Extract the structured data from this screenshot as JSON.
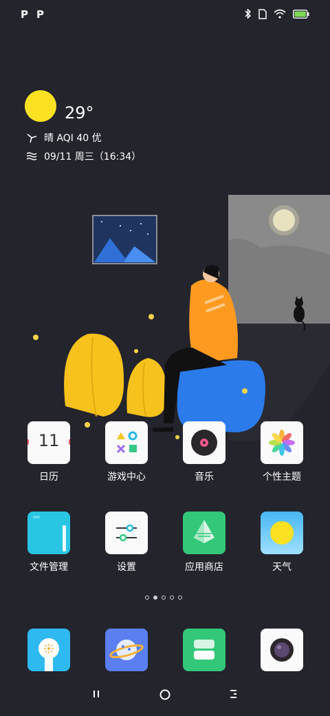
{
  "status_bar": {
    "left_icons": [
      "P",
      "P"
    ],
    "icons": [
      "bluetooth-icon",
      "sim-icon",
      "wifi-icon",
      "battery-icon"
    ],
    "battery_color": "#7ed957"
  },
  "weather": {
    "temperature": "29°",
    "condition_line": "晴 AQI 40 优",
    "date_line": "09/11 周三（16:34）",
    "sun_color": "#fbe122"
  },
  "apps_row1": [
    {
      "label": "日历",
      "icon": "calendar-icon",
      "number": "11"
    },
    {
      "label": "游戏中心",
      "icon": "game-center-icon"
    },
    {
      "label": "音乐",
      "icon": "music-icon"
    },
    {
      "label": "个性主题",
      "icon": "themes-icon"
    }
  ],
  "apps_row2": [
    {
      "label": "文件管理",
      "icon": "files-icon"
    },
    {
      "label": "设置",
      "icon": "settings-icon"
    },
    {
      "label": "应用商店",
      "icon": "app-store-icon"
    },
    {
      "label": "天气",
      "icon": "weather-icon"
    }
  ],
  "dock": [
    {
      "icon": "phone-icon"
    },
    {
      "icon": "browser-icon"
    },
    {
      "icon": "messages-icon"
    },
    {
      "icon": "camera-icon"
    }
  ],
  "page_indicator": {
    "count": 5,
    "active": 1
  },
  "nav_bar": [
    "menu-icon",
    "home-icon",
    "back-icon"
  ]
}
